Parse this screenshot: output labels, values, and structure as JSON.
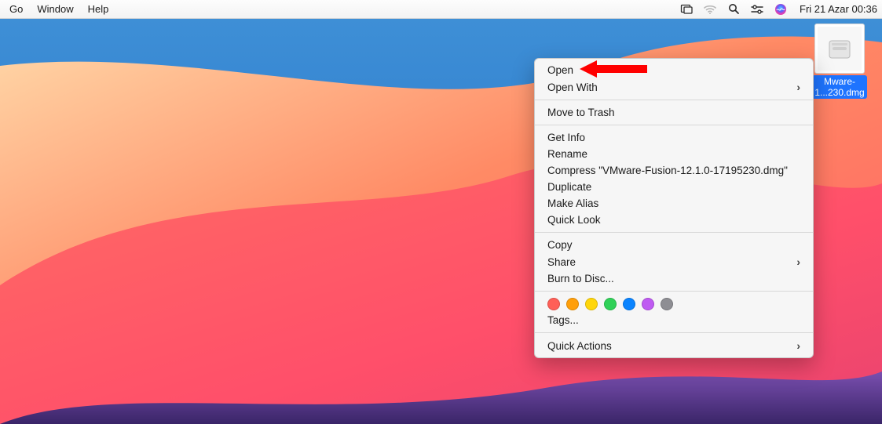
{
  "menubar": {
    "left": [
      "Go",
      "Window",
      "Help"
    ],
    "clock": "Fri 21 Azar  00:36"
  },
  "desktop": {
    "file": {
      "label_line1": "Mware-",
      "label_line2": "1...230.dmg"
    }
  },
  "contextmenu": {
    "open": "Open",
    "open_with": "Open With",
    "move_to_trash": "Move to Trash",
    "get_info": "Get Info",
    "rename": "Rename",
    "compress": "Compress \"VMware-Fusion-12.1.0-17195230.dmg\"",
    "duplicate": "Duplicate",
    "make_alias": "Make Alias",
    "quick_look": "Quick Look",
    "copy": "Copy",
    "share": "Share",
    "burn": "Burn to Disc...",
    "tag_dots": [
      "#ff5f57",
      "#ff9f0a",
      "#ffd60a",
      "#30d158",
      "#0a84ff",
      "#bf5af2",
      "#8e8e93"
    ],
    "tags": "Tags...",
    "quick_actions": "Quick Actions"
  },
  "annotation": {
    "color": "#ff0000"
  }
}
